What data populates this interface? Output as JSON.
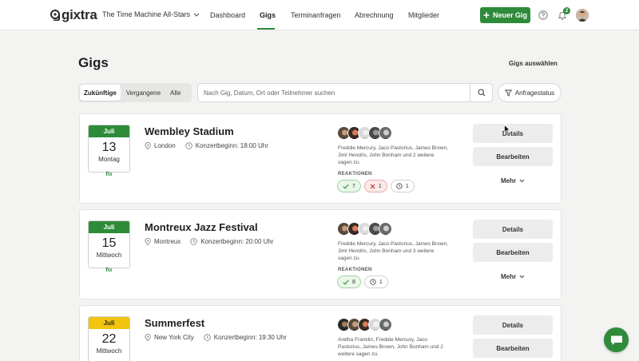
{
  "brand": {
    "logo_text": "gixtra",
    "accent": "#2e8b3a"
  },
  "band": {
    "name": "The Time Machine All-Stars"
  },
  "nav": {
    "items": [
      "Dashboard",
      "Gigs",
      "Terminanfragen",
      "Abrechnung",
      "Mitglieder"
    ],
    "active": "Gigs"
  },
  "header": {
    "new_gig": "Neuer Gig",
    "notification_count": "2"
  },
  "page": {
    "title": "Gigs",
    "select_label": "Gigs auswählen"
  },
  "filters": {
    "tabs": [
      "Zukünftige",
      "Vergangene",
      "Alle"
    ],
    "active_tab": "Zukünftige",
    "search_placeholder": "Nach Gig, Datum, Ort oder Teilnehmer suchen",
    "status_label": "Anfragestatus"
  },
  "gigs": [
    {
      "month": "Juli",
      "day": "13",
      "weekday": "Montag",
      "status": "fix",
      "month_color": "#2e8b3a",
      "title": "Wembley Stadium",
      "location": "London",
      "start": "Konzertbeginn: 18:00 Uhr",
      "participants": "Freddie Mercury, Jaco Pastorius, James Brown, Jimi Hendrix, John Bonham und 2 weitere sagen zu.",
      "reactions_label": "REAKTIONEN",
      "reactions": {
        "yes": "7",
        "no": "1",
        "pending": "1"
      },
      "details": "Details",
      "edit": "Bearbeiten",
      "more": "Mehr"
    },
    {
      "month": "Juli",
      "day": "15",
      "weekday": "Mittwoch",
      "status": "fix",
      "month_color": "#2e8b3a",
      "title": "Montreux Jazz Festival",
      "location": "Montreux",
      "start": "Konzertbeginn: 20:00 Uhr",
      "participants": "Freddie Mercury, Jaco Pastorius, James Brown, Jimi Hendrix, John Bonham und 3 weitere sagen zu.",
      "reactions_label": "REAKTIONEN",
      "reactions": {
        "yes": "8",
        "pending": "1"
      },
      "details": "Details",
      "edit": "Bearbeiten",
      "more": "Mehr"
    },
    {
      "month": "Juli",
      "day": "22",
      "weekday": "Mittwoch",
      "month_color": "#f2c40f",
      "title": "Summerfest",
      "location": "New York City",
      "start": "Konzertbeginn: 19:30 Uhr",
      "participants": "Aretha Franklin, Freddie Mercury, Jaco Pastorius, James Brown, John Bonham und 2 weitere sagen zu.",
      "details": "Details",
      "edit": "Bearbeiten"
    }
  ]
}
